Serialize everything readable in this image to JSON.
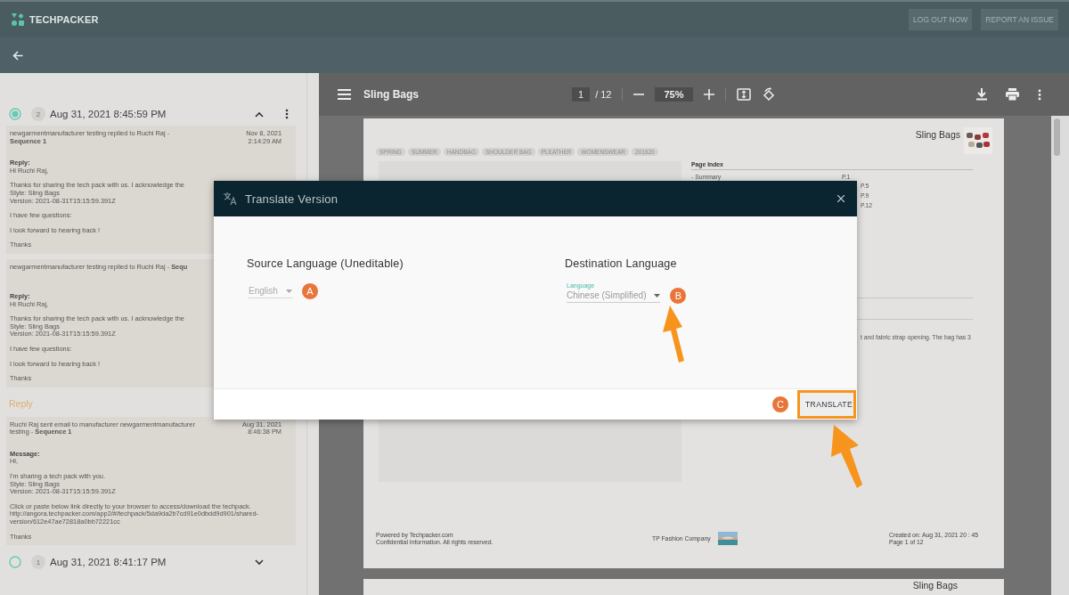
{
  "app": {
    "brand": "TECHPACKER",
    "buttons": [
      "LOG OUT NOW",
      "REPORT AN ISSUE"
    ]
  },
  "timeline": [
    {
      "number": "2",
      "date": "Aug 31, 2021 8:45:59 PM",
      "selected": true,
      "expanded": true,
      "messages": [
        {
          "kind": "message",
          "heading": "newgarmentmanufacturer testing replied to Ruchi Raj - **Sequence 1**",
          "date": "Nov 8, 2021 2:14:29 AM",
          "label": "Reply:",
          "paragraphs": [
            {
              "lines": [
                "Hi Ruchi Raj,"
              ]
            },
            {
              "lines": [
                "Thanks for sharing the tech pack with us. I acknowledge the",
                "Style: Sling Bags",
                "Version: 2021-08-31T15:15:59.391Z"
              ]
            },
            {
              "lines": [
                "I have few questions:"
              ]
            },
            {
              "lines": [
                "I look forward to hearing back !"
              ]
            },
            {
              "lines": [
                "Thanks"
              ]
            }
          ]
        },
        {
          "kind": "message",
          "heading": "newgarmentmanufacturer testing replied to Ruchi Raj - **Sequ**",
          "label": "Reply:",
          "paragraphs": [
            {
              "lines": [
                "Hi Ruchi Raj,"
              ]
            },
            {
              "lines": [
                "Thanks for sharing the tech pack with us. I acknowledge the",
                "Style: Sling Bags",
                "Version: 2021-08-31T15:15:59.391Z"
              ]
            },
            {
              "lines": [
                "I have few questions:"
              ]
            },
            {
              "lines": [
                "I look forward to hearing back !"
              ]
            },
            {
              "lines": [
                "Thanks"
              ]
            }
          ]
        },
        {
          "kind": "action",
          "label": "Reply"
        },
        {
          "kind": "message",
          "heading": "Ruchi Raj sent email to manufacturer newgarmentmanufacturer testing - **Sequence 1**",
          "date": "Aug 31, 2021 8:46:38 PM",
          "label": "Message:",
          "paragraphs": [
            {
              "lines": [
                "Hi,"
              ]
            },
            {
              "lines": [
                "I'm sharing a tech pack with you.",
                "Style: Sling Bags",
                "Version: 2021-08-31T15:15:59.391Z"
              ]
            },
            {
              "lines": [
                "Click or paste below link directly to your browser to access/download the techpack."
              ],
              "link": "http://angora.techpacker.com/app2/#/techpack/5da9da2b7cd91e0dbdd9d901/shared-version/612e47ae72818a0bb72221cc"
            },
            {
              "lines": [
                "Thanks"
              ]
            }
          ]
        }
      ]
    },
    {
      "number": "1",
      "date": "Aug 31, 2021 8:41:17 PM",
      "selected": false,
      "expanded": false
    }
  ],
  "viewer": {
    "title": "Sling Bags",
    "page": "1",
    "page_count": "/ 12",
    "zoom": "75%",
    "pages": [
      {
        "title": "Sling Bags",
        "tags": [
          "SPRING",
          "SUMMER",
          "HANDBAG",
          "SHOULDER BAG",
          "PLEATHER",
          "WOMENSWEAR",
          "201920"
        ],
        "index_heading": "Page Index",
        "index": [
          {
            "name": "- Summary",
            "page": "P.1"
          },
          {
            "page": "P.5"
          },
          {
            "page": "P.9"
          },
          {
            "page": "P.12"
          }
        ],
        "description": "t and fabric strap opening. The bag has 3",
        "footer": {
          "left": [
            "Powered by Techpacker.com",
            "Confidential Information. All rights reserved."
          ],
          "company": "TP Fashion Company",
          "right": [
            "Created on: Aug 31, 2021 20 : 45",
            "Page 1 of 12"
          ]
        }
      },
      {
        "title": "Sling Bags"
      }
    ]
  },
  "dialog": {
    "title": "Translate Version",
    "source": {
      "heading": "Source Language (Uneditable)",
      "value": "English",
      "disabled": true,
      "annotation": "A"
    },
    "destination": {
      "heading": "Destination Language",
      "label": "Language",
      "value": "Chinese (Simplified)",
      "disabled": false,
      "annotation": "B"
    },
    "annotation": "C",
    "button": {
      "label": "TRANSLATE",
      "highlighted": true
    }
  }
}
